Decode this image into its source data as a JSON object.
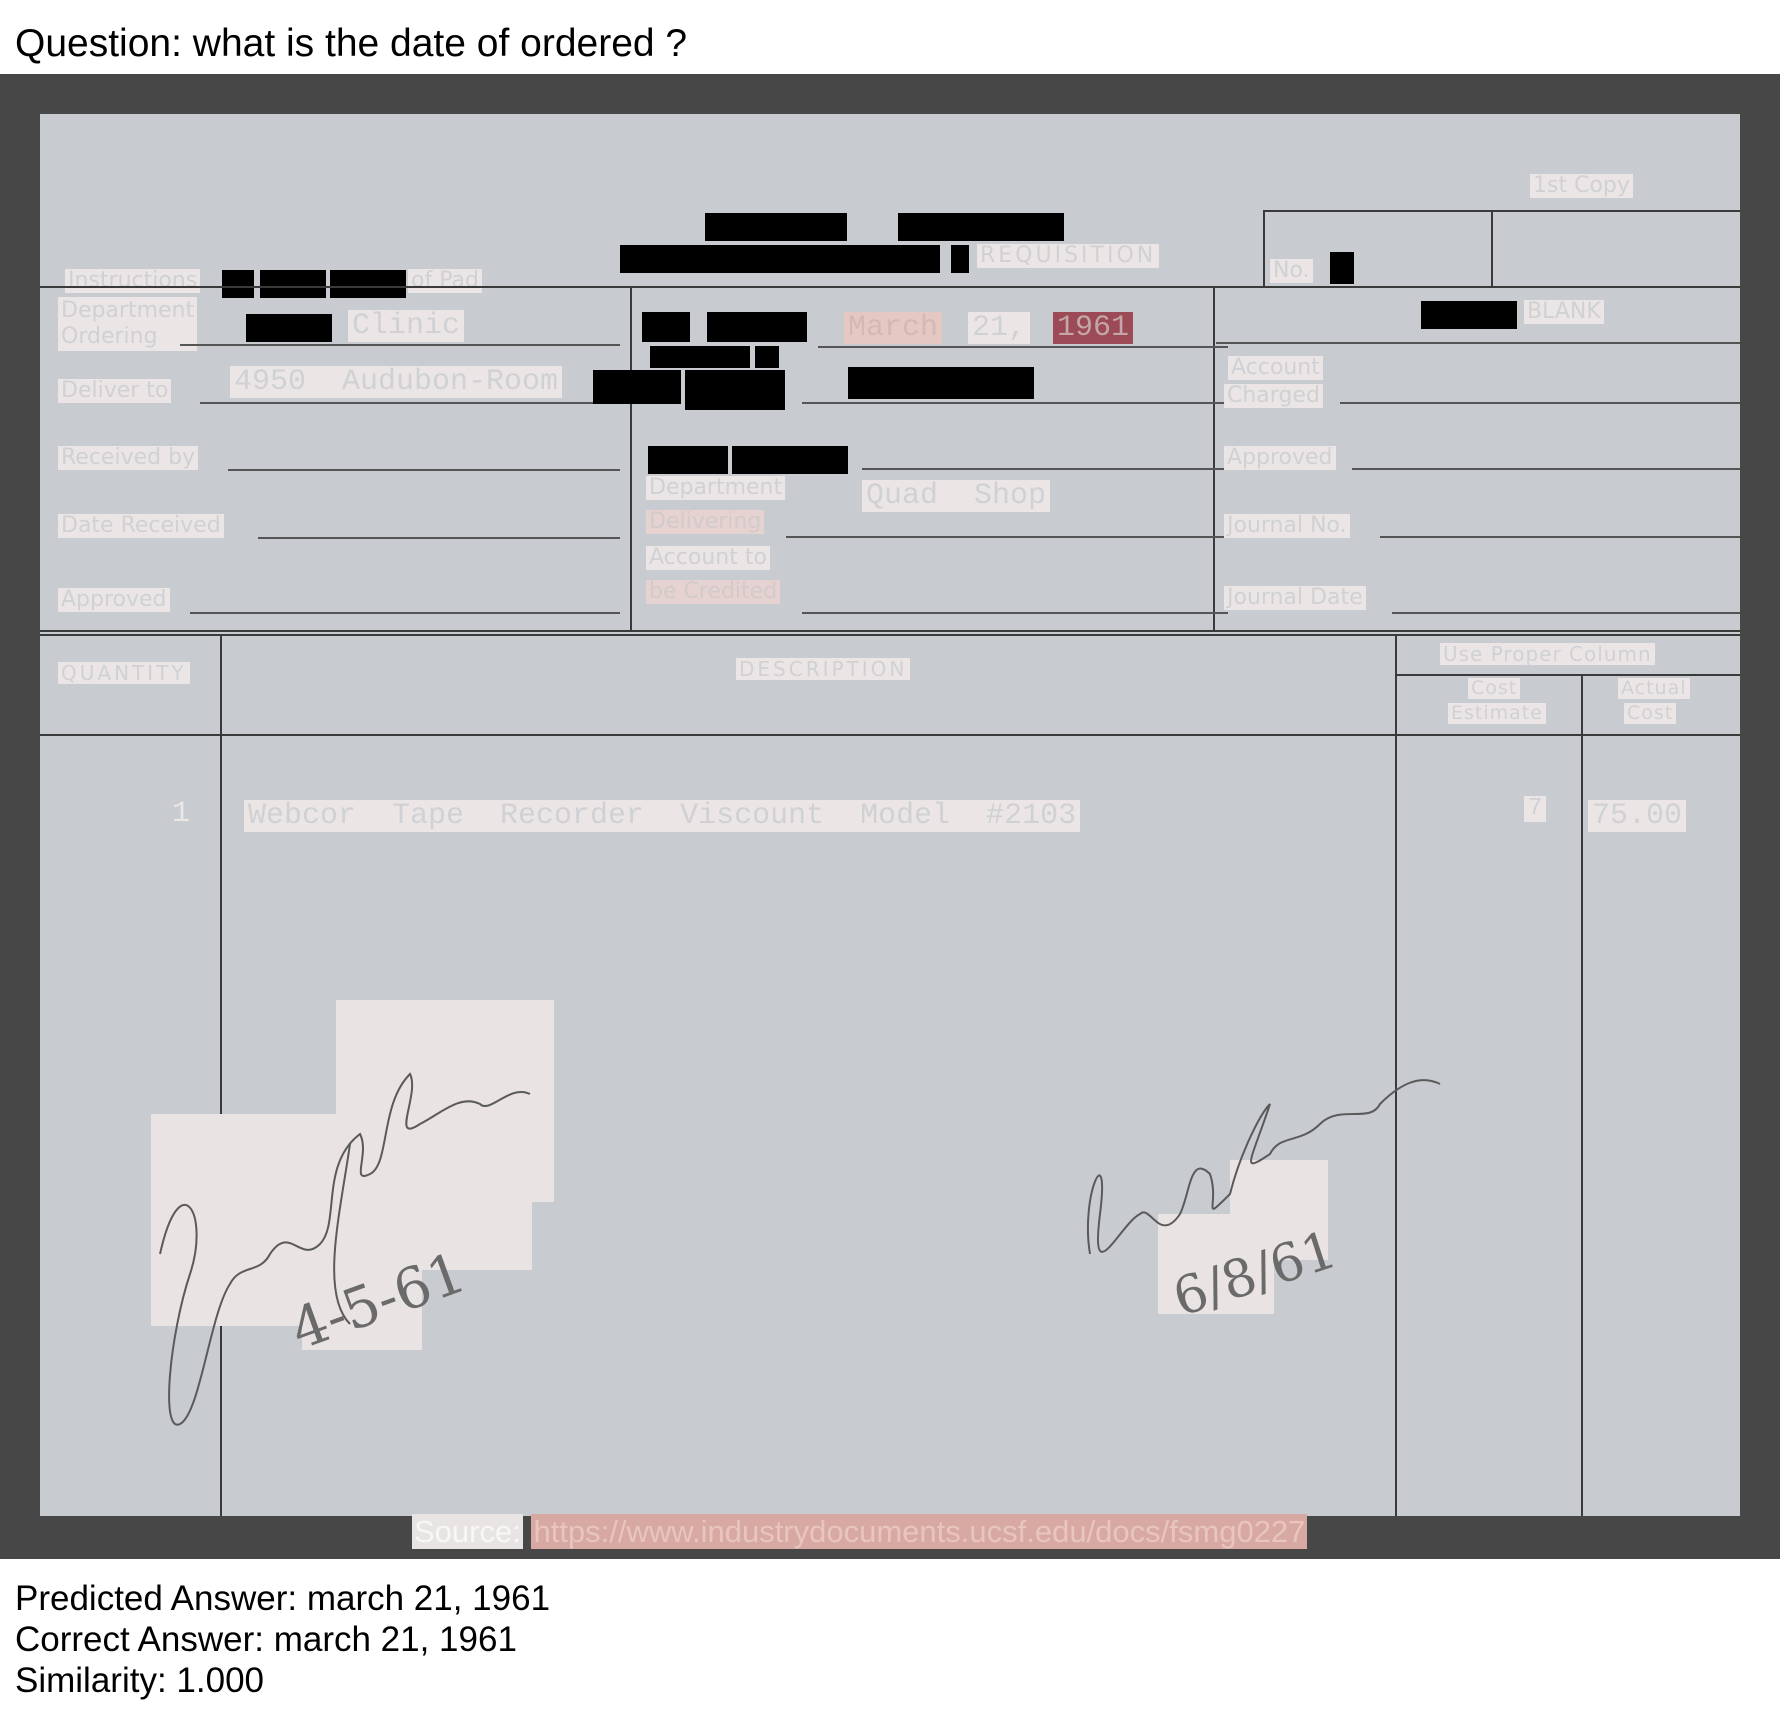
{
  "question": {
    "label": "Question:",
    "text": "what is the date of ordered ?"
  },
  "form": {
    "copy_label": "1st Copy",
    "title": "REQUISITION",
    "no_label": "No.",
    "instructions": [
      "Instructions",
      "of Pad"
    ],
    "blank": "BLANK",
    "left_fields": {
      "department_ordering": "Department\nOrdering",
      "deliver_to": "Deliver to",
      "received_by": "Received by",
      "date_received": "Date Received",
      "approved": "Approved"
    },
    "middle_fields": {
      "department_delivering": [
        "Department",
        "Delivering"
      ],
      "account_to_be_credited": [
        "Account to",
        "be Credited"
      ]
    },
    "right_fields": {
      "account_charged": [
        "Account",
        "Charged"
      ],
      "approved": "Approved",
      "journal_no": "Journal No.",
      "journal_date": "Journal Date"
    },
    "values": {
      "department": "Clinic",
      "deliver_to": "4950  Audubon-Room",
      "date_month": "March",
      "date_day": "21,",
      "date_year": "1961",
      "department_delivering": "Quad  Shop"
    },
    "table": {
      "headers": {
        "quantity": "QUANTITY",
        "description": "DESCRIPTION",
        "use_proper_column": "Use Proper Column",
        "cost_estimate": [
          "Cost",
          "Estimate"
        ],
        "actual_cost": [
          "Actual",
          "Cost"
        ]
      },
      "rows": [
        {
          "quantity": "1",
          "description": "Webcor  Tape  Recorder  Viscount  Model  #2103",
          "cost_estimate": "7",
          "actual_cost": "75.00"
        }
      ]
    },
    "signatures": {
      "left_date": "4-5-61",
      "right_date": "6/8/61"
    }
  },
  "source": {
    "label": "Source:",
    "url": "https://www.industrydocuments.ucsf.edu/docs/fsmg0227"
  },
  "answers": {
    "predicted_label": "Predicted Answer:",
    "predicted": "march 21, 1961",
    "correct_label": "Correct Answer:",
    "correct": "march 21, 1961",
    "similarity_label": "Similarity:",
    "similarity": "1.000"
  }
}
